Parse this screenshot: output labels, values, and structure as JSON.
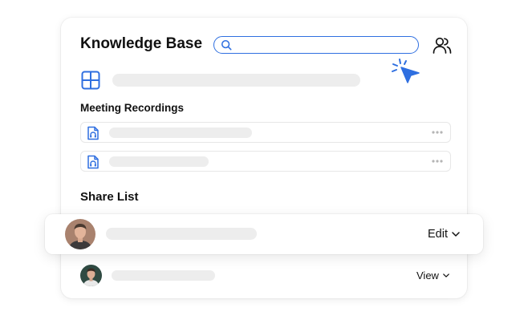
{
  "header": {
    "title": "Knowledge Base",
    "search": {
      "value": "",
      "placeholder": ""
    }
  },
  "sections": {
    "recordings_label": "Meeting Recordings",
    "share_label": "Share List"
  },
  "share_list": [
    {
      "permission": "Edit"
    },
    {
      "permission": "View"
    }
  ],
  "colors": {
    "accent": "#2f6fe0",
    "skeleton": "#ededed"
  }
}
